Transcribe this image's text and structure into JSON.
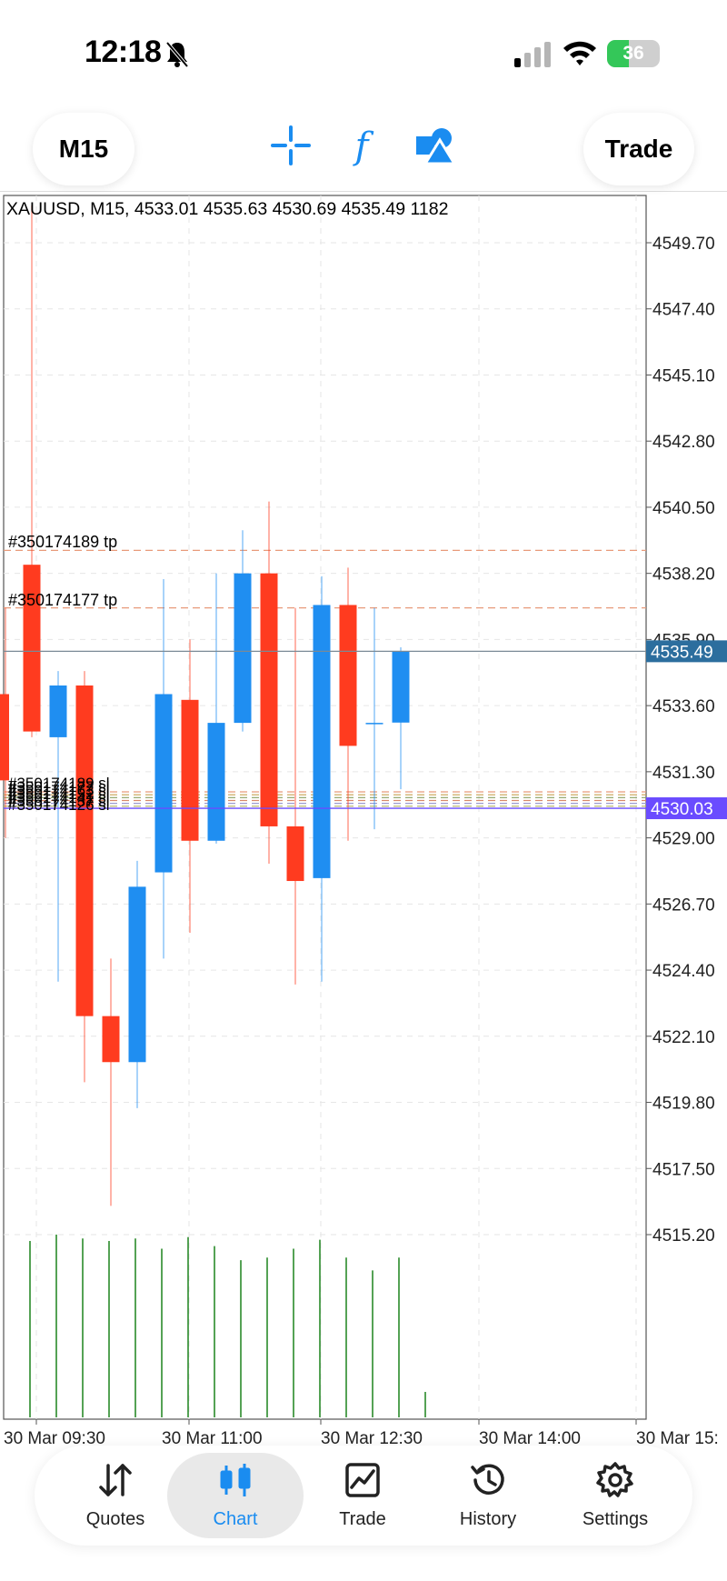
{
  "status_bar": {
    "time": "12:18",
    "battery": "36"
  },
  "toolbar": {
    "timeframe": "M15",
    "trade": "Trade",
    "icons": [
      "crosshair-icon",
      "function-icon",
      "objects-icon"
    ],
    "accent_color": "#1a8cf0"
  },
  "chart": {
    "title": "XAUUSD, M15, 4533.01 4535.63 4530.69 4535.49 1182",
    "price_labels": [
      "4549.70",
      "4547.40",
      "4545.10",
      "4542.80",
      "4540.50",
      "4538.20",
      "4535.90",
      "4533.60",
      "4531.30",
      "4529.00",
      "4526.70",
      "4524.40",
      "4522.10",
      "4519.80",
      "4517.50",
      "4515.20"
    ],
    "time_labels": [
      "30 Mar 09:30",
      "30 Mar 11:00",
      "30 Mar 12:30",
      "30 Mar 14:00",
      "30 Mar 15:"
    ],
    "current_bid": "4535.49",
    "position_price": "4530.03",
    "orders": [
      {
        "label": "#350174189 tp",
        "price": 4539.0,
        "color": "#e89a7a"
      },
      {
        "label": "#350174177 tp",
        "price": 4537.0,
        "color": "#e89a7a"
      }
    ],
    "sl_labels": [
      "#350174189 sl",
      "#350174177 sl",
      "#350174163 sl",
      "#350174152 sl",
      "#350174141 sl",
      "#350174137 sl",
      "#350174126 sl"
    ],
    "sl_prices": [
      4530.6,
      4530.5,
      4530.4,
      4530.3,
      4530.2,
      4530.1
    ],
    "colors": {
      "bull": "#1f8ef1",
      "bear": "#ff3b1f",
      "volume": "#2a8a2a",
      "bid_line": "#2c6e9e",
      "position_line": "#6a4cff"
    }
  },
  "chart_data": {
    "type": "candlestick",
    "symbol": "XAUUSD",
    "timeframe": "M15",
    "ylim": [
      4515.2,
      4549.7
    ],
    "candles": [
      {
        "open": 4534.0,
        "high": 4537.0,
        "low": 4529.0,
        "close": 4531.0
      },
      {
        "open": 4538.5,
        "high": 4551.0,
        "low": 4532.5,
        "close": 4532.7
      },
      {
        "open": 4532.5,
        "high": 4534.8,
        "low": 4524.0,
        "close": 4534.3
      },
      {
        "open": 4534.3,
        "high": 4534.8,
        "low": 4520.5,
        "close": 4522.8
      },
      {
        "open": 4522.8,
        "high": 4524.8,
        "low": 4516.2,
        "close": 4521.2
      },
      {
        "open": 4521.2,
        "high": 4528.2,
        "low": 4519.6,
        "close": 4527.3
      },
      {
        "open": 4527.8,
        "high": 4538.0,
        "low": 4524.8,
        "close": 4534.0
      },
      {
        "open": 4533.8,
        "high": 4535.9,
        "low": 4525.7,
        "close": 4528.9
      },
      {
        "open": 4528.9,
        "high": 4538.2,
        "low": 4528.8,
        "close": 4533.0
      },
      {
        "open": 4533.0,
        "high": 4539.7,
        "low": 4532.7,
        "close": 4538.2
      },
      {
        "open": 4538.2,
        "high": 4540.7,
        "low": 4528.1,
        "close": 4529.4
      },
      {
        "open": 4529.4,
        "high": 4537.0,
        "low": 4523.9,
        "close": 4527.5
      },
      {
        "open": 4527.6,
        "high": 4538.1,
        "low": 4524.0,
        "close": 4537.1
      },
      {
        "open": 4537.1,
        "high": 4538.4,
        "low": 4528.9,
        "close": 4532.2
      },
      {
        "open": 4533.0,
        "high": 4537.0,
        "low": 4529.3,
        "close": 4533.0
      },
      {
        "open": 4533.01,
        "high": 4535.63,
        "low": 4530.69,
        "close": 4535.49
      }
    ],
    "volumes": [
      1380,
      1430,
      1400,
      1380,
      1400,
      1320,
      1410,
      1340,
      1230,
      1250,
      1320,
      1390,
      1250,
      1150,
      1250,
      1182
    ]
  },
  "nav": {
    "items": [
      {
        "label": "Quotes",
        "icon": "quotes-icon"
      },
      {
        "label": "Chart",
        "icon": "chart-candles-icon"
      },
      {
        "label": "Trade",
        "icon": "trade-icon"
      },
      {
        "label": "History",
        "icon": "history-icon"
      },
      {
        "label": "Settings",
        "icon": "settings-icon"
      }
    ],
    "active": "Chart"
  }
}
